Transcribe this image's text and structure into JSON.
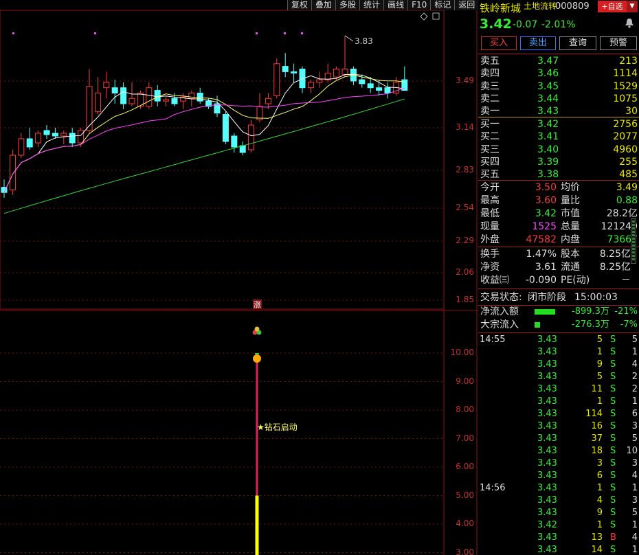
{
  "toolbar": [
    "复权",
    "叠加",
    "多股",
    "统计",
    "画线",
    "F10",
    "标记",
    "返回"
  ],
  "colors": {
    "up": "#ff3b3b",
    "down": "#54ffff",
    "ma5": "#ffffff",
    "ma10": "#ffff66",
    "ma20": "#ff44ff",
    "ma60": "#33dd33",
    "grid": "#7a1010"
  },
  "price_axis": [
    "3.49",
    "3.14",
    "2.83",
    "2.54",
    "2.29",
    "2.06",
    "1.85"
  ],
  "indicator_axis": [
    "10.00",
    "9.00",
    "8.00",
    "7.00",
    "6.00",
    "5.00",
    "4.00",
    "3.00"
  ],
  "chart_data": {
    "type": "candlestick",
    "high_label": "3.83",
    "candles": [
      {
        "o": 2.7,
        "h": 2.76,
        "l": 2.62,
        "c": 2.66
      },
      {
        "o": 2.68,
        "h": 2.98,
        "l": 2.64,
        "c": 2.94
      },
      {
        "o": 2.94,
        "h": 3.1,
        "l": 2.92,
        "c": 3.06
      },
      {
        "o": 3.06,
        "h": 3.14,
        "l": 2.98,
        "c": 3.0
      },
      {
        "o": 3.03,
        "h": 3.12,
        "l": 3.0,
        "c": 3.1
      },
      {
        "o": 3.12,
        "h": 3.16,
        "l": 3.06,
        "c": 3.09
      },
      {
        "o": 3.1,
        "h": 3.14,
        "l": 3.06,
        "c": 3.08
      },
      {
        "o": 3.08,
        "h": 3.12,
        "l": 3.02,
        "c": 3.1
      },
      {
        "o": 3.1,
        "h": 3.14,
        "l": 3.0,
        "c": 3.03
      },
      {
        "o": 3.03,
        "h": 3.14,
        "l": 3.0,
        "c": 3.12
      },
      {
        "o": 3.12,
        "h": 3.58,
        "l": 3.1,
        "c": 3.45
      },
      {
        "o": 3.26,
        "h": 3.52,
        "l": 3.24,
        "c": 3.4
      },
      {
        "o": 3.44,
        "h": 3.56,
        "l": 3.36,
        "c": 3.48
      },
      {
        "o": 3.44,
        "h": 3.5,
        "l": 3.32,
        "c": 3.4
      },
      {
        "o": 3.44,
        "h": 3.48,
        "l": 3.28,
        "c": 3.32
      },
      {
        "o": 3.32,
        "h": 3.48,
        "l": 3.3,
        "c": 3.36
      },
      {
        "o": 3.3,
        "h": 3.42,
        "l": 3.28,
        "c": 3.4
      },
      {
        "o": 3.3,
        "h": 3.48,
        "l": 3.28,
        "c": 3.44
      },
      {
        "o": 3.42,
        "h": 3.46,
        "l": 3.3,
        "c": 3.34
      },
      {
        "o": 3.34,
        "h": 3.38,
        "l": 3.3,
        "c": 3.35
      },
      {
        "o": 3.36,
        "h": 3.4,
        "l": 3.3,
        "c": 3.32
      },
      {
        "o": 3.34,
        "h": 3.4,
        "l": 3.28,
        "c": 3.37
      },
      {
        "o": 3.36,
        "h": 3.42,
        "l": 3.3,
        "c": 3.4
      },
      {
        "o": 3.4,
        "h": 3.44,
        "l": 3.32,
        "c": 3.34
      },
      {
        "o": 3.34,
        "h": 3.36,
        "l": 3.28,
        "c": 3.3
      },
      {
        "o": 3.32,
        "h": 3.38,
        "l": 3.22,
        "c": 3.25
      },
      {
        "o": 3.24,
        "h": 3.26,
        "l": 3.02,
        "c": 3.04
      },
      {
        "o": 3.08,
        "h": 3.1,
        "l": 2.96,
        "c": 3.0
      },
      {
        "o": 3.01,
        "h": 3.04,
        "l": 2.94,
        "c": 2.96
      },
      {
        "o": 2.98,
        "h": 3.2,
        "l": 2.96,
        "c": 3.16
      },
      {
        "o": 3.2,
        "h": 3.4,
        "l": 3.18,
        "c": 3.3
      },
      {
        "o": 3.32,
        "h": 3.4,
        "l": 3.28,
        "c": 3.36
      },
      {
        "o": 3.38,
        "h": 3.66,
        "l": 3.36,
        "c": 3.62
      },
      {
        "o": 3.6,
        "h": 3.7,
        "l": 3.52,
        "c": 3.56
      },
      {
        "o": 3.56,
        "h": 3.62,
        "l": 3.48,
        "c": 3.55
      },
      {
        "o": 3.58,
        "h": 3.6,
        "l": 3.4,
        "c": 3.44
      },
      {
        "o": 3.44,
        "h": 3.5,
        "l": 3.4,
        "c": 3.48
      },
      {
        "o": 3.48,
        "h": 3.56,
        "l": 3.44,
        "c": 3.5
      },
      {
        "o": 3.5,
        "h": 3.62,
        "l": 3.48,
        "c": 3.55
      },
      {
        "o": 3.52,
        "h": 3.6,
        "l": 3.5,
        "c": 3.58
      },
      {
        "o": 3.54,
        "h": 3.83,
        "l": 3.52,
        "c": 3.58
      },
      {
        "o": 3.58,
        "h": 3.6,
        "l": 3.46,
        "c": 3.49
      },
      {
        "o": 3.5,
        "h": 3.54,
        "l": 3.44,
        "c": 3.47
      },
      {
        "o": 3.47,
        "h": 3.52,
        "l": 3.4,
        "c": 3.44
      },
      {
        "o": 3.44,
        "h": 3.5,
        "l": 3.38,
        "c": 3.42
      },
      {
        "o": 3.44,
        "h": 3.48,
        "l": 3.36,
        "c": 3.4
      },
      {
        "o": 3.4,
        "h": 3.52,
        "l": 3.38,
        "c": 3.48
      },
      {
        "o": 3.5,
        "h": 3.6,
        "l": 3.42,
        "c": 3.42
      }
    ],
    "ma_pixel_note": "",
    "indicator": {
      "label": "★钻石启动",
      "marker": "涨",
      "bar_top": 10.0,
      "bar_yellow_top": 5.0,
      "bar_bottom": 3.0
    }
  },
  "panel": {
    "name": "铁岭新城",
    "tag": "土地流转",
    "code": "000809",
    "add_btn": "+自选",
    "price": "3.42",
    "change": "-0.07",
    "pct": "-2.01%",
    "actions": [
      "买入",
      "卖出",
      "查询",
      "预警"
    ],
    "asks": [
      {
        "label": "卖五",
        "price": "3.47",
        "vol": "213"
      },
      {
        "label": "卖四",
        "price": "3.46",
        "vol": "1114"
      },
      {
        "label": "卖三",
        "price": "3.45",
        "vol": "1529"
      },
      {
        "label": "卖二",
        "price": "3.44",
        "vol": "1075"
      },
      {
        "label": "卖一",
        "price": "3.43",
        "vol": "30"
      }
    ],
    "bids": [
      {
        "label": "买一",
        "price": "3.42",
        "vol": "2756"
      },
      {
        "label": "买二",
        "price": "3.41",
        "vol": "2077"
      },
      {
        "label": "买三",
        "price": "3.40",
        "vol": "4960"
      },
      {
        "label": "买四",
        "price": "3.39",
        "vol": "255"
      },
      {
        "label": "买五",
        "price": "3.38",
        "vol": "485"
      }
    ],
    "stats": [
      {
        "l1": "今开",
        "v1": "3.50",
        "c1": "#ff3b3b",
        "l2": "均价",
        "v2": "3.49",
        "c2": "#e6e600"
      },
      {
        "l1": "最高",
        "v1": "3.60",
        "c1": "#ff3b3b",
        "l2": "量比",
        "v2": "0.88",
        "c2": "#33ee33"
      },
      {
        "l1": "最低",
        "v1": "3.42",
        "c1": "#33ee33",
        "l2": "市值",
        "v2": "28.2亿",
        "c2": "#ddd"
      },
      {
        "l1": "现量",
        "v1": "1525",
        "c1": "#ff44ff",
        "l2": "总量",
        "v2": "121249",
        "c2": "#ddd"
      },
      {
        "l1": "外盘",
        "v1": "47582",
        "c1": "#ff3b3b",
        "l2": "内盘",
        "v2": "73667",
        "c2": "#33ee33"
      }
    ],
    "stats2": [
      {
        "l1": "换手",
        "v1": "1.47%",
        "l2": "股本",
        "v2": "8.25亿"
      },
      {
        "l1": "净资",
        "v1": "3.61",
        "l2": "流通",
        "v2": "8.25亿"
      },
      {
        "l1": "收益㈢",
        "v1": "-0.090",
        "l2": "PE(动)",
        "v2": "－"
      }
    ],
    "trade_status_label": "交易状态:",
    "trade_status": "闭市阶段",
    "trade_time": "15:00:03",
    "flows": [
      {
        "label": "净流入额",
        "value": "-899.3万",
        "pct": "-21%",
        "fill": 0.65
      },
      {
        "label": "大宗流入",
        "value": "-276.3万",
        "pct": "-7%",
        "fill": 0.18
      }
    ],
    "ticks": [
      {
        "time": "14:55",
        "price": "3.43",
        "vol": "5",
        "side": "S",
        "n": "5"
      },
      {
        "time": "",
        "price": "3.43",
        "vol": "1",
        "side": "S",
        "n": "1"
      },
      {
        "time": "",
        "price": "3.43",
        "vol": "9",
        "side": "S",
        "n": "4"
      },
      {
        "time": "",
        "price": "3.43",
        "vol": "5",
        "side": "S",
        "n": "2"
      },
      {
        "time": "",
        "price": "3.43",
        "vol": "11",
        "side": "S",
        "n": "2"
      },
      {
        "time": "",
        "price": "3.43",
        "vol": "1",
        "side": "S",
        "n": "1"
      },
      {
        "time": "",
        "price": "3.43",
        "vol": "114",
        "side": "S",
        "n": "6"
      },
      {
        "time": "",
        "price": "3.43",
        "vol": "16",
        "side": "S",
        "n": "3"
      },
      {
        "time": "",
        "price": "3.43",
        "vol": "37",
        "side": "S",
        "n": "5"
      },
      {
        "time": "",
        "price": "3.43",
        "vol": "18",
        "side": "S",
        "n": "10"
      },
      {
        "time": "",
        "price": "3.43",
        "vol": "3",
        "side": "S",
        "n": "3"
      },
      {
        "time": "",
        "price": "3.43",
        "vol": "6",
        "side": "S",
        "n": "4"
      },
      {
        "time": "14:56",
        "price": "3.43",
        "vol": "1",
        "side": "S",
        "n": "1"
      },
      {
        "time": "",
        "price": "3.43",
        "vol": "4",
        "side": "S",
        "n": "3"
      },
      {
        "time": "",
        "price": "3.43",
        "vol": "9",
        "side": "S",
        "n": "5"
      },
      {
        "time": "",
        "price": "3.42",
        "vol": "1",
        "side": "S",
        "n": "1"
      },
      {
        "time": "",
        "price": "3.43",
        "vol": "13",
        "side": "B",
        "n": "4"
      },
      {
        "time": "",
        "price": "3.43",
        "vol": "14",
        "side": "S",
        "n": "1"
      }
    ]
  }
}
